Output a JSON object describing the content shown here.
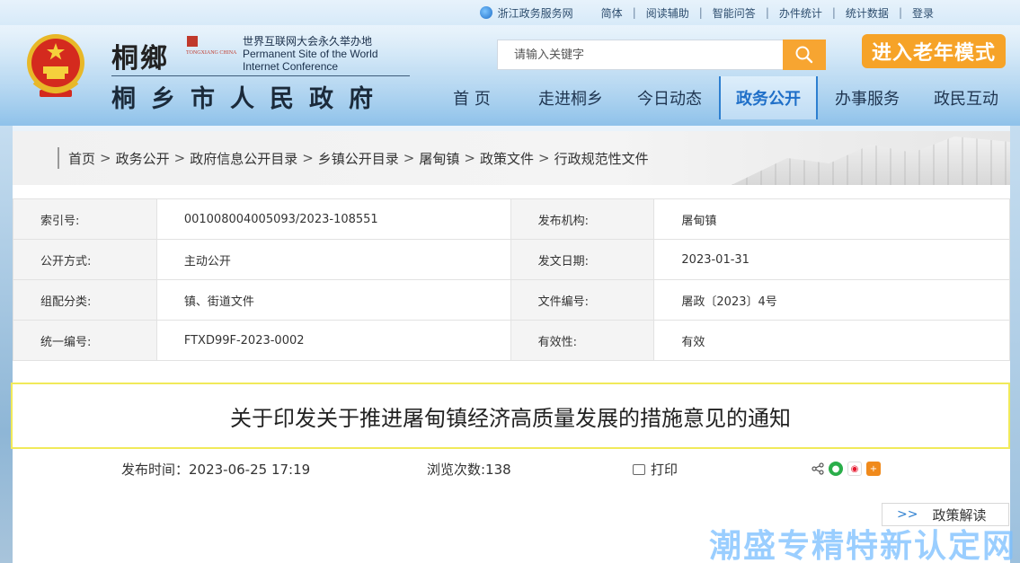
{
  "topbar": {
    "zhejiang": "浙江政务服务网",
    "items": [
      "简体",
      "阅读辅助",
      "智能问答",
      "办件统计",
      "统计数据",
      "登录"
    ]
  },
  "branding": {
    "calligraphy": "桐鄉",
    "seal_text": "TONGXIANG CHINA",
    "wic_line1": "世界互联网大会永久举办地",
    "wic_line2": "Permanent Site of the World",
    "wic_line3": "Internet Conference",
    "site_name": "桐乡市人民政府"
  },
  "search": {
    "placeholder": "请输入关键字"
  },
  "elder_mode": "进入老年模式",
  "nav": {
    "tabs": [
      "首 页",
      "走进桐乡",
      "今日动态",
      "政务公开",
      "办事服务",
      "政民互动"
    ],
    "active": "政务公开"
  },
  "breadcrumb": [
    "首页",
    "政务公开",
    "政府信息公开目录",
    "乡镇公开目录",
    "屠甸镇",
    "政策文件",
    "行政规范性文件"
  ],
  "info": {
    "rows": [
      {
        "k1": "索引号:",
        "v1": "001008004005093/2023-108551",
        "k2": "发布机构:",
        "v2": "屠甸镇"
      },
      {
        "k1": "公开方式:",
        "v1": "主动公开",
        "k2": "发文日期:",
        "v2": "2023-01-31"
      },
      {
        "k1": "组配分类:",
        "v1": "镇、街道文件",
        "k2": "文件编号:",
        "v2": "屠政〔2023〕4号"
      },
      {
        "k1": "统一编号:",
        "v1": "FTXD99F-2023-0002",
        "k2": "有效性:",
        "v2": "有效"
      }
    ]
  },
  "doc_title": "关于印发关于推进屠甸镇经济高质量发展的措施意见的通知",
  "meta": {
    "publish_time": "发布时间：2023-06-25  17:19",
    "views": "浏览次数:138",
    "print": "打印"
  },
  "policy_button": {
    "arrow": ">>",
    "label": "政策解读"
  },
  "watermark": "潮盛专精特新认定网",
  "colors": {
    "accent": "#f7a531",
    "nav_active": "#1f6fc8",
    "title_border": "#f1ea5a"
  }
}
